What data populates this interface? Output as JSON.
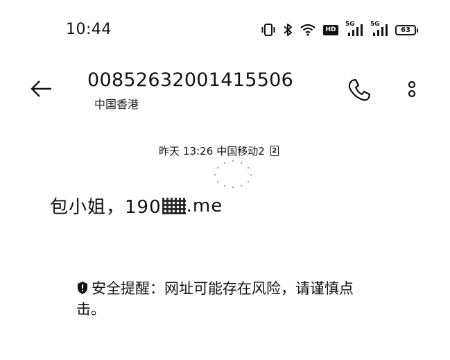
{
  "status_bar": {
    "time": "10:44",
    "icons": [
      "vibrate-icon",
      "bluetooth-icon",
      "wifi-icon",
      "hd-icon",
      "signal-5g-icon",
      "signal-5g-icon",
      "battery-icon"
    ],
    "hd_label": "HD",
    "network_1": "5G",
    "network_2": "5G",
    "battery_level": "63"
  },
  "header": {
    "sender_number": "00852632001415506",
    "sender_region": "中国香港",
    "icons": [
      "back-arrow-icon",
      "phone-icon",
      "more-vertical-icon"
    ]
  },
  "message": {
    "meta_date": "昨天",
    "meta_time": "13:26",
    "meta_carrier": "中国移动2",
    "sim_slot": "2",
    "body_prefix": "包小姐，190",
    "body_suffix": ".me"
  },
  "security": {
    "icon": "shield-icon",
    "text": "安全提醒：网址可能存在风险，请谨慎点击。"
  }
}
